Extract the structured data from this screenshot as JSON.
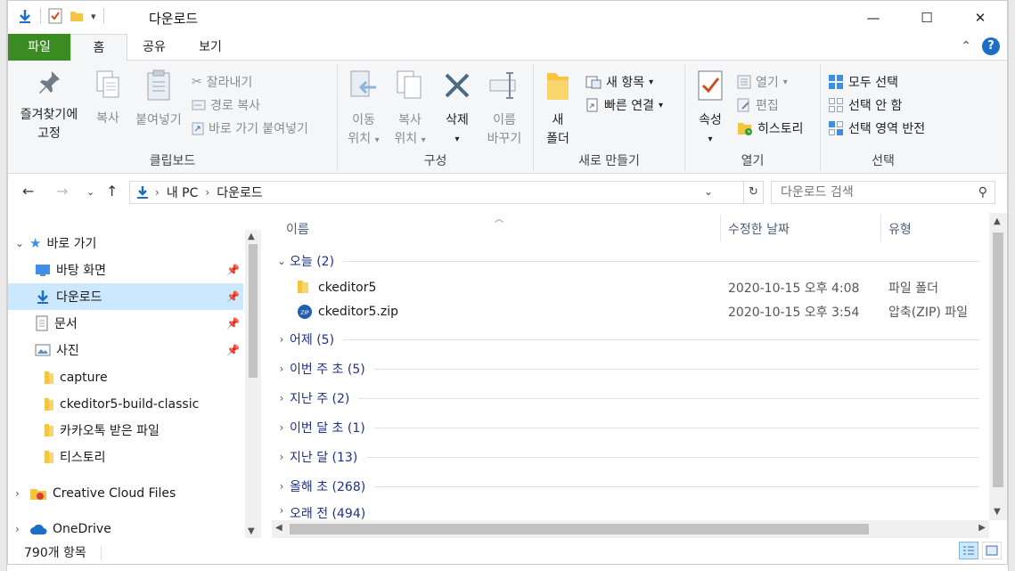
{
  "window": {
    "title": "다운로드",
    "controls": {
      "minimize": "—",
      "maximize": "☐",
      "close": "✕"
    }
  },
  "tabs": [
    {
      "label": "파일"
    },
    {
      "label": "홈"
    },
    {
      "label": "공유"
    },
    {
      "label": "보기"
    }
  ],
  "ribbon": {
    "clipboard": {
      "label": "클립보드",
      "pin": "즐겨찾기에",
      "pin2": "고정",
      "copy": "복사",
      "paste": "붙여넣기",
      "cut": "잘라내기",
      "copy_path": "경로 복사",
      "paste_shortcut": "바로 가기 붙여넣기"
    },
    "organize": {
      "label": "구성",
      "move1": "이동",
      "move2": "위치",
      "copyto1": "복사",
      "copyto2": "위치",
      "delete": "삭제",
      "rename1": "이름",
      "rename2": "바꾸기"
    },
    "new": {
      "label": "새로 만들기",
      "new_folder1": "새",
      "new_folder2": "폴더",
      "new_item": "새 항목",
      "easy_access": "빠른 연결"
    },
    "open": {
      "label": "열기",
      "properties": "속성",
      "open": "열기",
      "edit": "편집",
      "history": "히스토리"
    },
    "select": {
      "label": "선택",
      "select_all": "모두 선택",
      "select_none": "선택 안 함",
      "invert": "선택 영역 반전"
    }
  },
  "address": {
    "crumbs": [
      "내 PC",
      "다운로드"
    ],
    "search_placeholder": "다운로드 검색"
  },
  "nav": {
    "quick_access": "바로 가기",
    "items": [
      {
        "label": "바탕 화면",
        "pinned": true
      },
      {
        "label": "다운로드",
        "pinned": true
      },
      {
        "label": "문서",
        "pinned": true
      },
      {
        "label": "사진",
        "pinned": true
      },
      {
        "label": "capture",
        "pinned": false
      },
      {
        "label": "ckeditor5-build-classic",
        "pinned": false
      },
      {
        "label": "카카오톡 받은 파일",
        "pinned": false
      },
      {
        "label": "티스토리",
        "pinned": false
      }
    ],
    "creative_cloud": "Creative Cloud Files",
    "onedrive": "OneDrive"
  },
  "columns": {
    "name": "이름",
    "modified": "수정한 날짜",
    "type": "유형"
  },
  "groups": {
    "today": "오늘 (2)",
    "yesterday": "어제 (5)",
    "this_week": "이번 주 초 (5)",
    "last_week": "지난 주 (2)",
    "this_month": "이번 달 초 (1)",
    "last_month": "지난 달 (13)",
    "this_year": "올해 초 (268)",
    "long_ago": "오래 전 (494)"
  },
  "files": [
    {
      "name": "ckeditor5",
      "date": "2020-10-15 오후 4:08",
      "type": "파일 폴더"
    },
    {
      "name": "ckeditor5.zip",
      "date": "2020-10-15 오후 3:54",
      "type": "압축(ZIP) 파일"
    }
  ],
  "status": {
    "count": "790개 항목"
  },
  "colors": {
    "file_tab": "#3a8b22",
    "selection": "#cce8ff",
    "accent": "#1e6ec8",
    "folder": "#f5c542"
  }
}
